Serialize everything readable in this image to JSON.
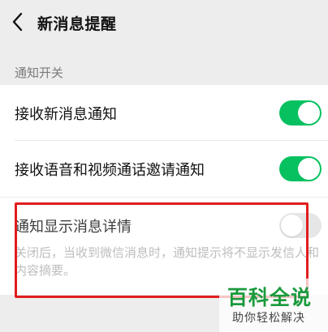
{
  "header": {
    "back_icon": "chevron-left-icon",
    "title": "新消息提醒"
  },
  "section": {
    "label": "通知开关"
  },
  "settings": {
    "items": [
      {
        "label": "接收新消息通知",
        "enabled": true
      },
      {
        "label": "接收语音和视频通话邀请通知",
        "enabled": true
      }
    ]
  },
  "detail": {
    "label": "通知显示消息详情",
    "enabled": false,
    "description": "关闭后，当收到微信消息时，通知提示将不显示发信人和内容摘要。"
  },
  "colors": {
    "accent": "#07c160",
    "highlight": "#e11d1d",
    "watermark": "#1a9a3c"
  },
  "watermark": {
    "main": "百科全说",
    "sub": "助你轻松解决"
  }
}
